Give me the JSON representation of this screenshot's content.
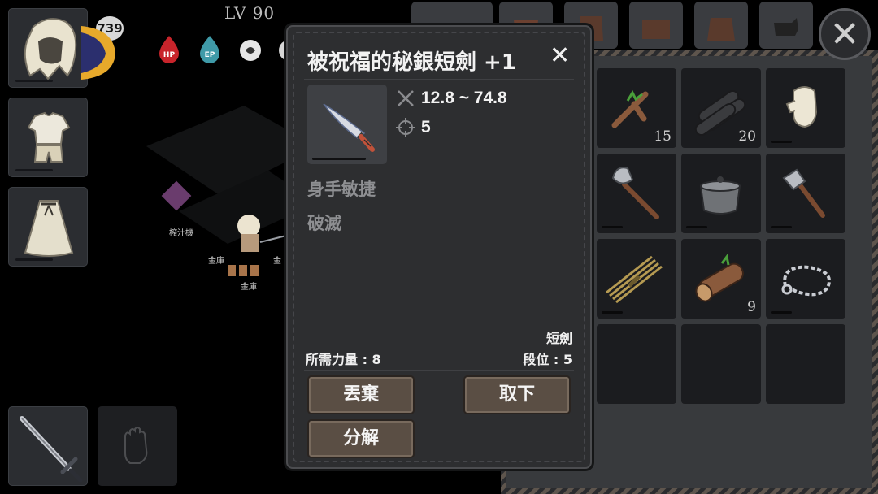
{
  "hud": {
    "level": "LV 90",
    "level_badge": "739",
    "stats": [
      {
        "label": "HP",
        "color": "#c8242b"
      },
      {
        "label": "EP",
        "color": "#3f9aa8"
      },
      {
        "label": "stamina",
        "color": "#e6e6e6"
      }
    ]
  },
  "world": {
    "labels": [
      "榨汁機",
      "金庫",
      "金庫",
      "金",
      "金庫"
    ]
  },
  "inventory": {
    "items": [
      {
        "icon": "branch-icon",
        "count": "15"
      },
      {
        "icon": "logs-icon",
        "count": "20"
      },
      {
        "icon": "mitten-icon",
        "count": ""
      },
      {
        "icon": "axe-icon",
        "count": ""
      },
      {
        "icon": "pot-icon",
        "count": ""
      },
      {
        "icon": "hatchet-icon",
        "count": ""
      },
      {
        "icon": "straw-bundle-icon",
        "count": ""
      },
      {
        "icon": "log-icon",
        "count": "9"
      },
      {
        "icon": "chain-icon",
        "count": ""
      },
      {
        "icon": "",
        "count": ""
      },
      {
        "icon": "",
        "count": ""
      },
      {
        "icon": "",
        "count": ""
      }
    ]
  },
  "dialog": {
    "title": "被祝福的秘銀短劍 +1",
    "close": "✕",
    "attack": "12.8 ~ 74.8",
    "accuracy": "5",
    "traits": [
      "身手敏捷",
      "破滅"
    ],
    "weapon_type": "短劍",
    "required_strength": "所需力量 : 8",
    "tier": "段位 : 5",
    "buttons": {
      "discard": "丟棄",
      "unequip": "取下",
      "disassemble": "分解"
    }
  },
  "close_button": "✕"
}
